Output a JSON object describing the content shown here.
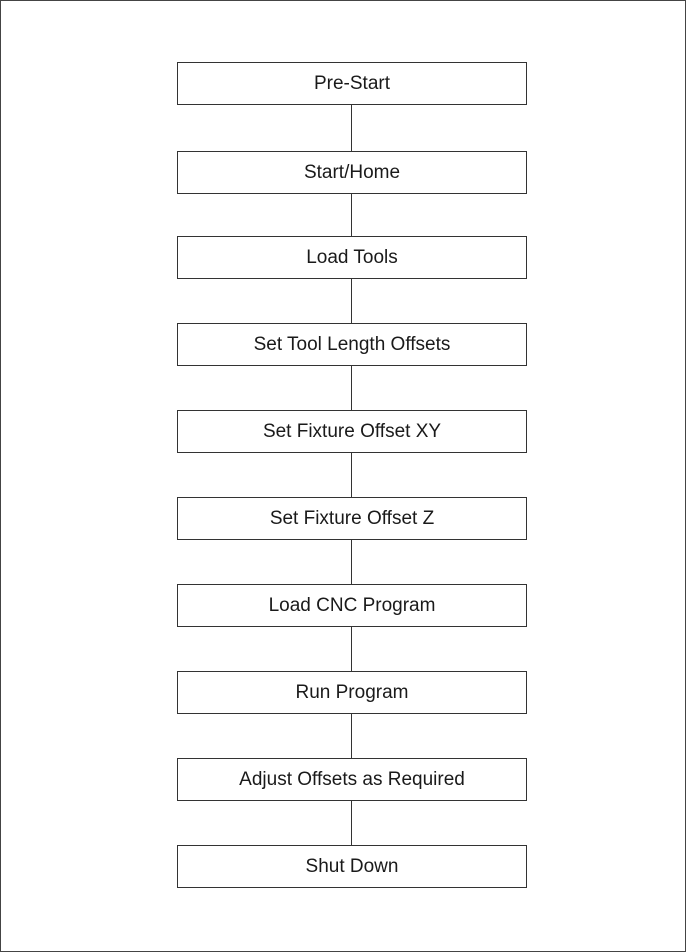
{
  "diagram": {
    "steps": [
      {
        "label": "Pre-Start"
      },
      {
        "label": "Start/Home"
      },
      {
        "label": "Load Tools"
      },
      {
        "label": "Set Tool Length Offsets"
      },
      {
        "label": "Set Fixture Offset XY"
      },
      {
        "label": "Set Fixture Offset Z"
      },
      {
        "label": "Load CNC Program"
      },
      {
        "label": "Run Program"
      },
      {
        "label": "Adjust Offsets as Required"
      },
      {
        "label": "Shut Down"
      }
    ]
  }
}
